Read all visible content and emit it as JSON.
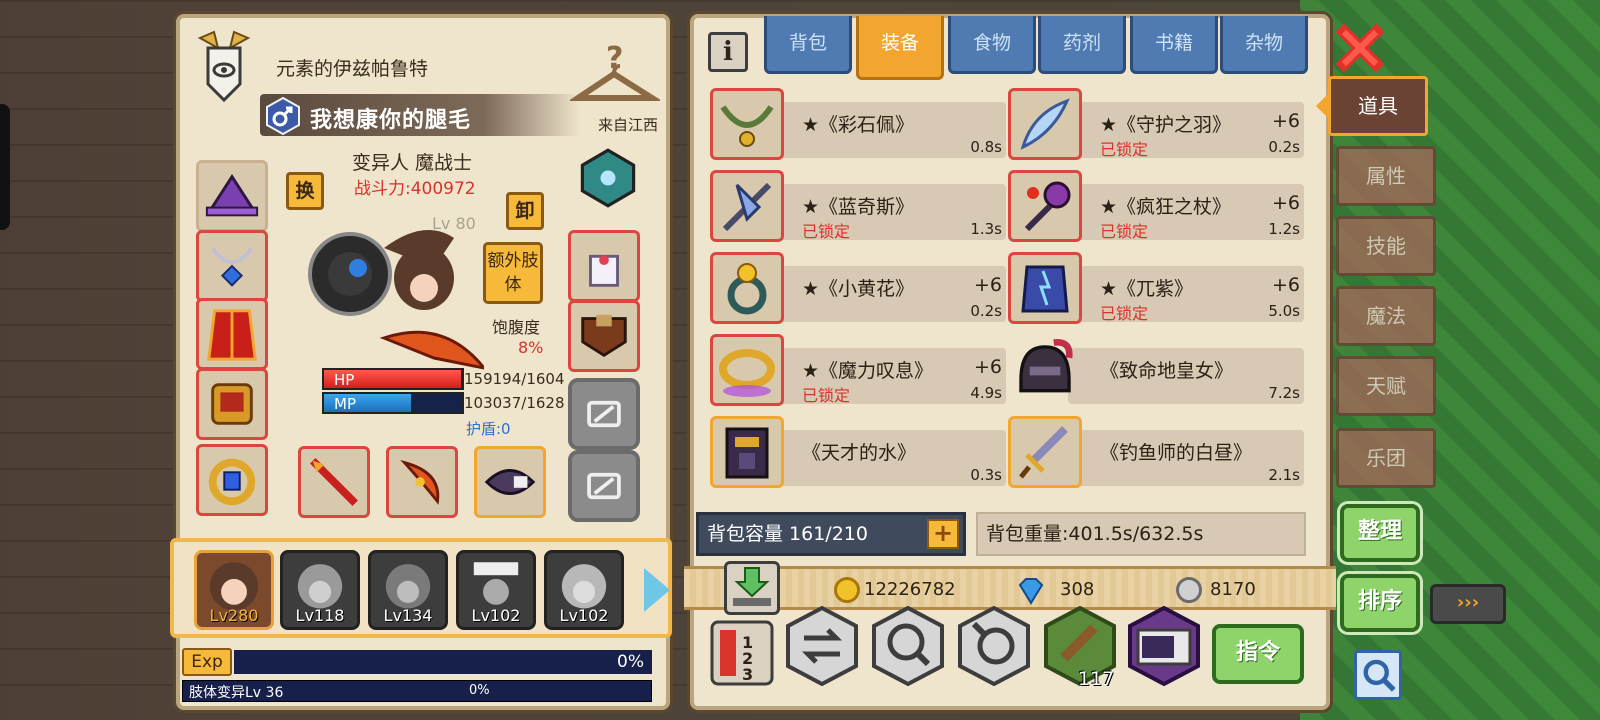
{
  "character": {
    "title": "元素的伊兹帕鲁特",
    "name": "我想康你的腿毛",
    "origin": "来自江西",
    "race_class": "变异人 魔战士",
    "power": "战斗力:400972",
    "level_text": "Lv 80",
    "swap_label": "换",
    "unequip_label": "卸",
    "extra_limb_label": "额外肢体",
    "satiety_label": "饱腹度",
    "satiety_value": "8%",
    "hp_label": "HP",
    "mp_label": "MP",
    "hp_value": "159194/1604",
    "mp_value": "103037/1628",
    "hp_fraction": 0.99,
    "mp_fraction": 0.63,
    "shield": "护盾:0"
  },
  "party": [
    {
      "level": "Lv280",
      "active": true
    },
    {
      "level": "Lv118",
      "active": false
    },
    {
      "level": "Lv134",
      "active": false
    },
    {
      "level": "Lv102",
      "active": false
    },
    {
      "level": "Lv102",
      "active": false
    }
  ],
  "exp": {
    "label": "Exp",
    "percent": "0%",
    "mutation_label": "肢体变异Lv 36",
    "mutation_percent": "0%"
  },
  "inventory": {
    "tabs": [
      "背包",
      "装备",
      "食物",
      "药剂",
      "书籍",
      "杂物"
    ],
    "active_tab": 1,
    "items": [
      {
        "name": "★《彩石佩》",
        "plus": "",
        "locked": "",
        "weight": "0.8s",
        "icon": "stone-necklace-icon"
      },
      {
        "name": "★《守护之羽》",
        "plus": "+6",
        "locked": "已锁定",
        "weight": "0.2s",
        "icon": "feather-icon"
      },
      {
        "name": "★《蓝奇斯》",
        "plus": "",
        "locked": "已锁定",
        "weight": "1.3s",
        "icon": "axe-icon"
      },
      {
        "name": "★《疯狂之杖》",
        "plus": "+6",
        "locked": "已锁定",
        "weight": "1.2s",
        "icon": "mace-icon"
      },
      {
        "name": "★《小黄花》",
        "plus": "+6",
        "locked": "",
        "weight": "0.2s",
        "icon": "flower-ring-icon"
      },
      {
        "name": "★《兀紫》",
        "plus": "+6",
        "locked": "已锁定",
        "weight": "5.0s",
        "icon": "purple-armor-icon"
      },
      {
        "name": "★《魔力叹息》",
        "plus": "+6",
        "locked": "已锁定",
        "weight": "4.9s",
        "icon": "gold-ring-icon"
      },
      {
        "name": "《致命地皇女》",
        "plus": "",
        "locked": "",
        "weight": "7.2s",
        "icon": "dark-helmet-icon"
      },
      {
        "name": "《天才的水》",
        "plus": "",
        "locked": "",
        "weight": "0.3s",
        "icon": "dark-armor-icon"
      },
      {
        "name": "《钓鱼师的白昼》",
        "plus": "",
        "locked": "",
        "weight": "2.1s",
        "icon": "sword-icon"
      }
    ],
    "capacity": "背包容量 161/210",
    "weight_total": "背包重量:401.5s/632.5s",
    "gold": "12226782",
    "diamond": "308",
    "silver": "8170",
    "hotbar_count": "117",
    "command_label": "指令"
  },
  "side_tabs": [
    "道具",
    "属性",
    "技能",
    "魔法",
    "天赋",
    "乐团"
  ],
  "side_active": 0,
  "sort_label": "整理",
  "order_label": "排序",
  "arrows_label": "›››",
  "colors": {
    "accent": "#f2a630",
    "tab_blue": "#4f7bb2",
    "lock_red": "#d8332c",
    "green": "#8fd46a"
  }
}
